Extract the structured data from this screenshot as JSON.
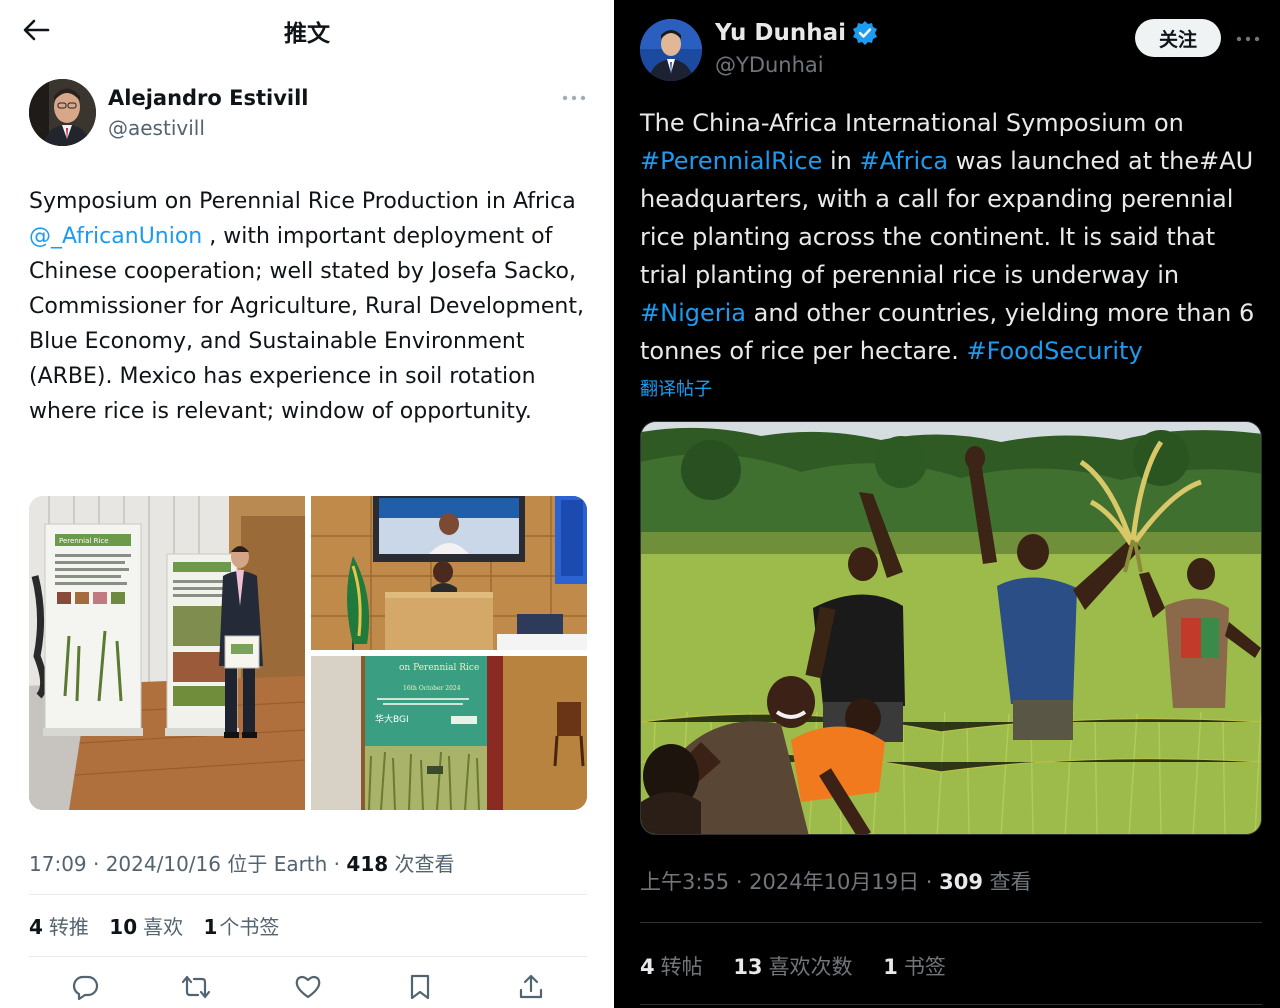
{
  "left_tweet": {
    "header_title": "推文",
    "author": {
      "name": "Alejandro Estivill",
      "handle": "@aestivill"
    },
    "text": {
      "part1": "Symposium on Perennial Rice Production in Africa ",
      "mention": "@_AfricanUnion",
      "part2": " , with important deployment of Chinese cooperation; well stated by Josefa Sacko, Commissioner for Agriculture, Rural Development, Blue Economy, and Sustainable Environment (ARBE). Mexico has experience in soil rotation where rice is relevant; window of opportunity."
    },
    "photos": [
      {
        "kind": "man standing beside perennial rice poster banners"
      },
      {
        "kind": "speaker at podium with African Union flag and screen"
      },
      {
        "kind": "banner: on Perennial Rice, 16th October 2024, 华大BGI"
      }
    ],
    "photo_text": {
      "banner_title": "on Perennial Rice",
      "banner_date": "16th October 2024",
      "banner_logo": "华大BGI",
      "poster_title": "Perennial Rice"
    },
    "meta": {
      "time": "17:09 · 2024/10/16 位于 Earth · ",
      "views_count": "418",
      "views_label": " 次查看"
    },
    "stats": {
      "retweets_count": "4",
      "retweets_label": "转推",
      "likes_count": "10",
      "likes_label": "喜欢",
      "bookmarks_count": "1",
      "bookmarks_label": "个书签"
    },
    "actions": [
      "reply-icon",
      "retweet-icon",
      "like-icon",
      "bookmark-icon",
      "share-icon"
    ]
  },
  "right_tweet": {
    "author": {
      "name": "Yu Dunhai",
      "handle": "@YDunhai",
      "verified": true
    },
    "follow_label": "关注",
    "text": {
      "p1": "The China-Africa International Symposium on ",
      "tag1": "#PerennialRice",
      "p2": " in ",
      "tag2": "#Africa",
      "p3": " was launched at the#AU headquarters, with a call for expanding perennial rice planting across the continent. It is said that trial planting of perennial rice is underway in ",
      "tag3": "#Nigeria",
      "p4": " and other countries, yielding more than 6 tonnes of rice per hectare. ",
      "tag4": "#FoodSecurity"
    },
    "translate_label": "翻译帖子",
    "photo": {
      "kind": "farmers waving in green rice field, one holding rice stalks"
    },
    "meta": {
      "time": "上午3:55 · 2024年10月19日 · ",
      "views_count": "309",
      "views_label": " 查看"
    },
    "stats": {
      "reposts_count": "4",
      "reposts_label": "转帖",
      "likes_count": "13",
      "likes_label": "喜欢次数",
      "bookmarks_count": "1",
      "bookmarks_label": "书签"
    }
  },
  "colors": {
    "link_blue": "#1d9bf0",
    "light_text": "#0f1419",
    "light_secondary": "#536471",
    "dark_text": "#e7e9ea",
    "dark_secondary": "#71767b",
    "verified_blue": "#1d9bf0"
  }
}
